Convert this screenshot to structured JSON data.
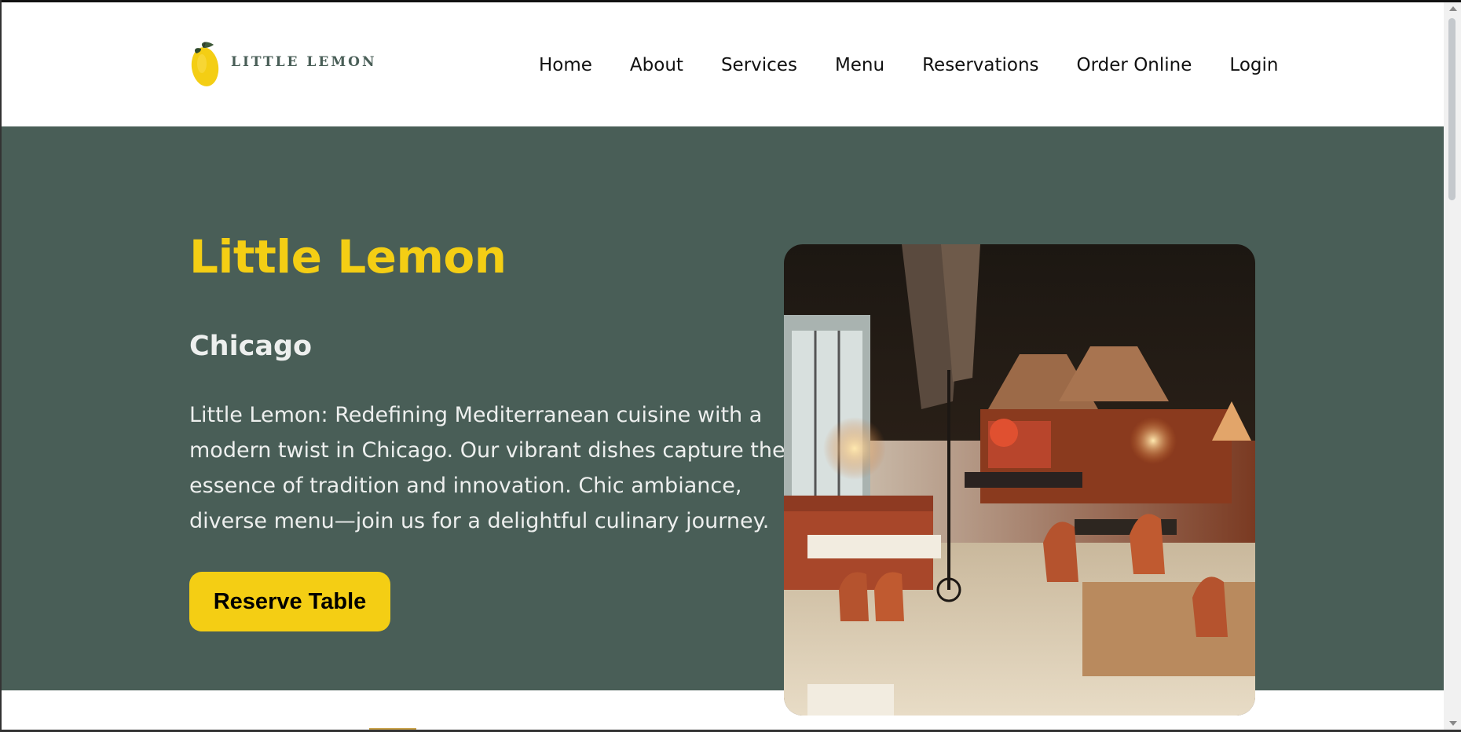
{
  "brand": {
    "name": "LITTLE LEMON",
    "logo_icon": "lemon-icon",
    "colors": {
      "primary_green": "#495e57",
      "primary_yellow": "#f4ce14",
      "light": "#edefee"
    }
  },
  "nav": {
    "items": [
      {
        "label": "Home"
      },
      {
        "label": "About"
      },
      {
        "label": "Services"
      },
      {
        "label": "Menu"
      },
      {
        "label": "Reservations"
      },
      {
        "label": "Order Online"
      },
      {
        "label": "Login"
      }
    ]
  },
  "hero": {
    "title": "Little Lemon",
    "subtitle": "Chicago",
    "description": "Little Lemon: Redefining Mediterranean cuisine with a modern twist in Chicago. Our vibrant dishes capture the essence of tradition and innovation. Chic ambiance, diverse menu—join us for a delightful culinary journey.",
    "cta_label": "Reserve Table",
    "image_alt": "Restaurant interior"
  }
}
